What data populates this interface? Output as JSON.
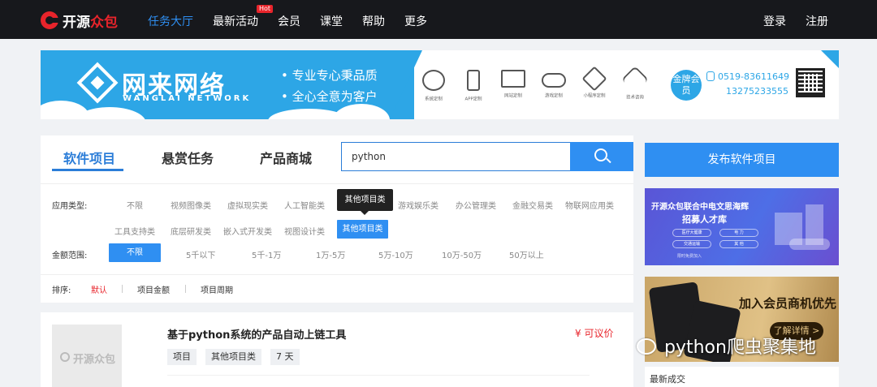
{
  "nav": {
    "logo_a": "开源",
    "logo_b": "众包",
    "items": [
      "任务大厅",
      "最新活动",
      "会员",
      "课堂",
      "帮助",
      "更多"
    ],
    "hot_badge": "Hot",
    "login": "登录",
    "register": "注册"
  },
  "banner": {
    "title": "网来网络",
    "subtitle": "WANGLAI NETWORK",
    "slogan1": "• 专业专心秉品质",
    "slogan2": "• 全心全意为客户",
    "services": [
      "系统定制",
      "APP定制",
      "网站定制",
      "游戏定制",
      "小程序定制",
      "技术咨询"
    ],
    "gold_member": "金牌会员",
    "phone1": "0519-83611649",
    "phone2": "13275233555"
  },
  "tabs": [
    "软件项目",
    "悬赏任务",
    "产品商城"
  ],
  "search": {
    "value": "python"
  },
  "filters": {
    "app_type_label": "应用类型:",
    "app_types_row1": [
      "不限",
      "视频图像类",
      "虚拟现实类",
      "人工智能类",
      "游戏娱乐类",
      "办公管理类",
      "金融交易类",
      "物联网应用类"
    ],
    "app_types_row2": [
      "工具支持类",
      "底层研发类",
      "嵌入式开发类",
      "视图设计类",
      "其他项目类"
    ],
    "tooltip": "其他项目类",
    "amount_label": "金额范围:",
    "amounts": [
      "不限",
      "5千以下",
      "5千-1万",
      "1万-5万",
      "5万-10万",
      "10万-50万",
      "50万以上"
    ],
    "sort_label": "排序:",
    "sorts": [
      "默认",
      "项目金额",
      "项目周期"
    ]
  },
  "listing": {
    "thumb_text": "开源众包",
    "title": "基于python系统的产品自动上链工具",
    "price": "¥ 可议价",
    "tags": [
      "项目",
      "其他项目类",
      "7 天"
    ]
  },
  "sidebar": {
    "publish_button": "发布软件项目",
    "ad1_title": "开源众包联合中电文思海辉",
    "ad1_sub": "招募人才库",
    "ad1_pills": [
      "医疗大健康",
      "电 力",
      "交通运输",
      "其 他"
    ],
    "ad1_note": "限时免费加入",
    "ad2_title": "加入会员商机优先",
    "ad2_button": "了解详情 >",
    "recent": "最新成交"
  },
  "watermark": "python爬虫聚集地",
  "colors": {
    "accent": "#2f8ff2",
    "brand_red": "#e8242b",
    "nav_bg": "#17181c",
    "banner_blue": "#2da6e6"
  }
}
